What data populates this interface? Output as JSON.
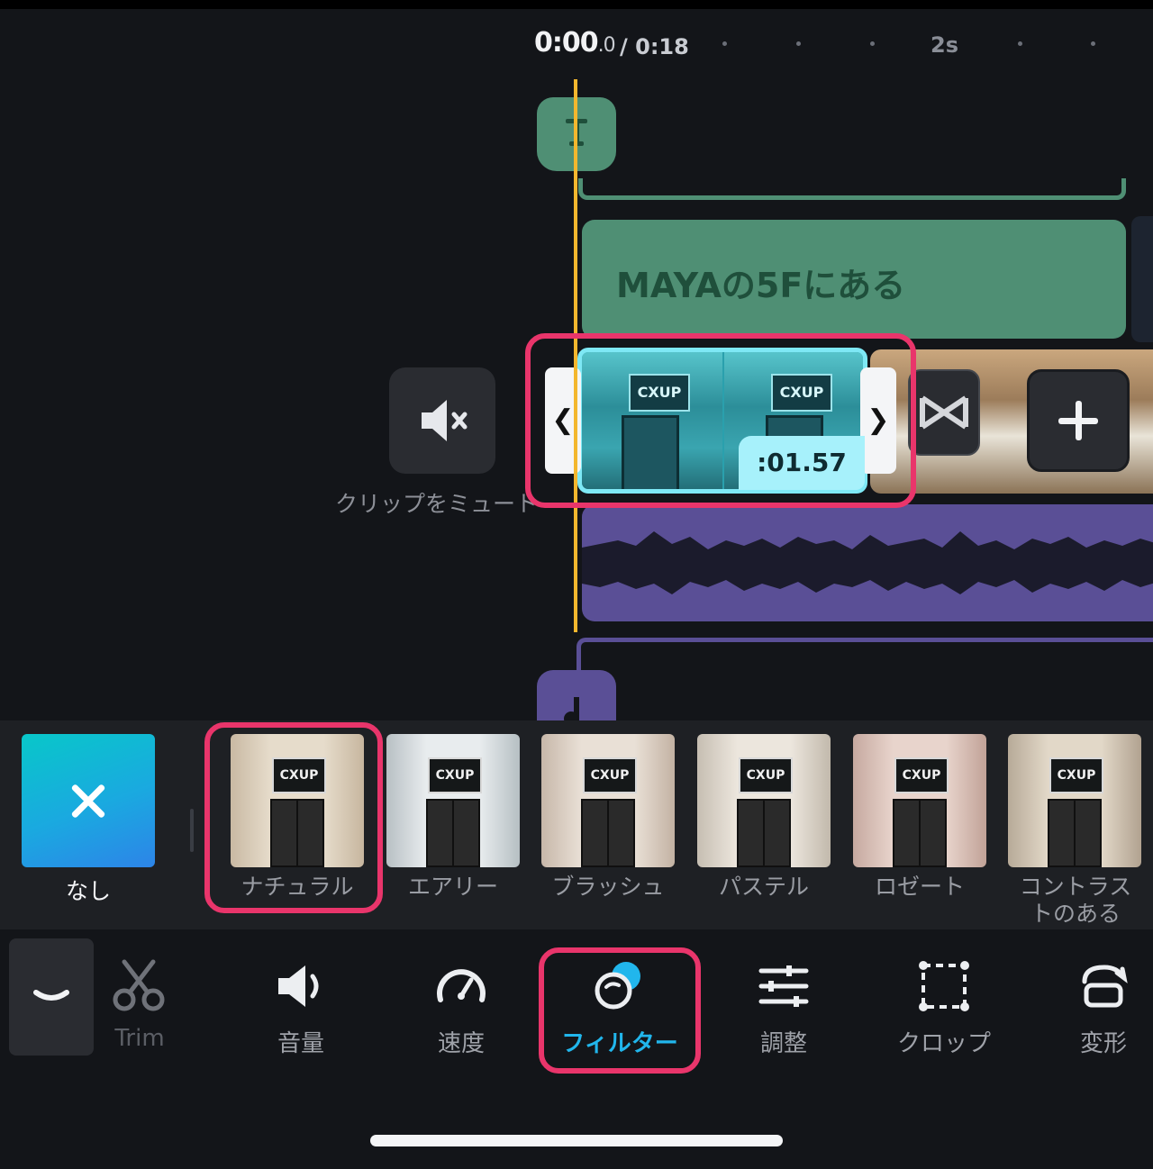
{
  "timeline": {
    "current_time": "0:00",
    "current_time_fraction": ".0",
    "separator": "/",
    "total_time": "0:18",
    "ruler_mark": "2s"
  },
  "text_track": {
    "clip_text": "MAYAの5Fにある"
  },
  "video_track": {
    "selected_clip_duration": ":01.57",
    "mute_label": "クリップをミュート",
    "thumbnail_sign": "CXUP"
  },
  "filters": {
    "none_label": "なし",
    "items": [
      {
        "label": "ナチュラル"
      },
      {
        "label": "エアリー"
      },
      {
        "label": "ブラッシュ"
      },
      {
        "label": "パステル"
      },
      {
        "label": "ロゼート"
      },
      {
        "label": "コントラストのある"
      }
    ]
  },
  "toolbar": {
    "items": [
      {
        "label": "Trim",
        "icon": "scissors-icon"
      },
      {
        "label": "音量",
        "icon": "volume-icon"
      },
      {
        "label": "速度",
        "icon": "speedometer-icon"
      },
      {
        "label": "フィルター",
        "icon": "filter-icon"
      },
      {
        "label": "調整",
        "icon": "sliders-icon"
      },
      {
        "label": "クロップ",
        "icon": "crop-icon"
      },
      {
        "label": "変形",
        "icon": "transform-icon"
      }
    ]
  },
  "colors": {
    "accent_highlight": "#e9356b",
    "playhead": "#f3b72e",
    "text_track": "#4f8f74",
    "audio_track": "#5a4f96",
    "active_tool": "#21b6ec"
  }
}
